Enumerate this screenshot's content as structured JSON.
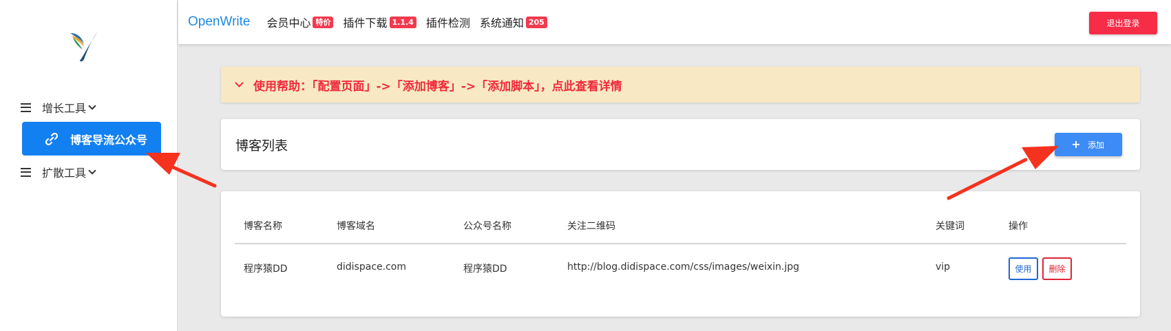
{
  "topbar": {
    "brand": "OpenWrite",
    "nav": [
      {
        "label": "会员中心",
        "badge": "特价"
      },
      {
        "label": "插件下载",
        "badge": "1.1.4"
      },
      {
        "label": "插件检测",
        "badge": ""
      },
      {
        "label": "系统通知",
        "badge": "205"
      }
    ],
    "logout_label": "退出登录"
  },
  "sidebar": {
    "groups": [
      {
        "label": "增长工具"
      },
      {
        "label": "扩散工具"
      }
    ],
    "active_item": "博客导流公众号"
  },
  "help": {
    "text": "使用帮助：「配置页面」->「添加博客」->「添加脚本」，点此查看详情"
  },
  "blog_list": {
    "title": "博客列表",
    "add_label": "添加"
  },
  "table": {
    "headers": [
      "博客名称",
      "博客域名",
      "公众号名称",
      "关注二维码",
      "关键词",
      "操作"
    ],
    "rows": [
      {
        "name": "程序猿DD",
        "domain": "didispace.com",
        "account": "程序猿DD",
        "qrcode": "http://blog.didispace.com/css/images/weixin.jpg",
        "keyword": "vip",
        "use_label": "使用",
        "delete_label": "删除"
      }
    ]
  },
  "colors": {
    "accent": "#1280f0",
    "danger": "#f72c47",
    "help_bg": "#f8e9c4",
    "annotation_arrow": "#f5321e"
  }
}
